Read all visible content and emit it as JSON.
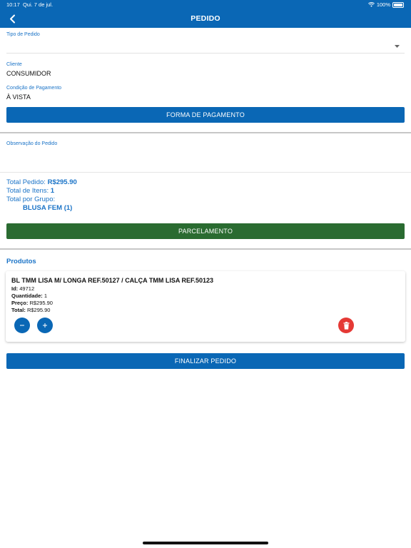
{
  "status_bar": {
    "time": "10:17",
    "date": "Qui. 7 de jul.",
    "battery": "100%"
  },
  "header": {
    "title": "PEDIDO"
  },
  "form": {
    "tipo_label": "Tipo de Pedido",
    "tipo_value": "",
    "cliente_label": "Cliente",
    "cliente_value": "CONSUMIDOR",
    "condicao_label": "Condição de Pagamento",
    "condicao_value": "À VISTA",
    "forma_button": "FORMA DE PAGAMENTO",
    "observacao_label": "Observação do Pedido",
    "observacao_value": ""
  },
  "totals": {
    "total_pedido_label": "Total Pedido:",
    "total_pedido_value": "R$295.90",
    "total_itens_label": "Total de Itens:",
    "total_itens_value": "1",
    "total_grupo_label": "Total por Grupo:",
    "grupo_item": "BLUSA FEM (1)"
  },
  "parcelamento_button": "PARCELAMENTO",
  "produtos": {
    "title": "Produtos",
    "items": [
      {
        "name": "BL TMM LISA M/ LONGA REF.50127 / CALÇA TMM LISA REF.50123",
        "id_label": "Id:",
        "id_value": "49712",
        "qty_label": "Quantidade:",
        "qty_value": "1",
        "price_label": "Preço:",
        "price_value": "R$295.90",
        "total_label": "Total:",
        "total_value": "R$295.90"
      }
    ]
  },
  "finalizar_button": "FINALIZAR PEDIDO",
  "colors": {
    "primary": "#0a67b5",
    "green": "#2a6b31",
    "delete": "#e53935",
    "label": "#1a73c7"
  },
  "icons": [
    "back-arrow-icon",
    "dropdown-arrow-icon",
    "minus-icon",
    "plus-icon",
    "trash-icon",
    "wifi-icon",
    "battery-icon"
  ]
}
